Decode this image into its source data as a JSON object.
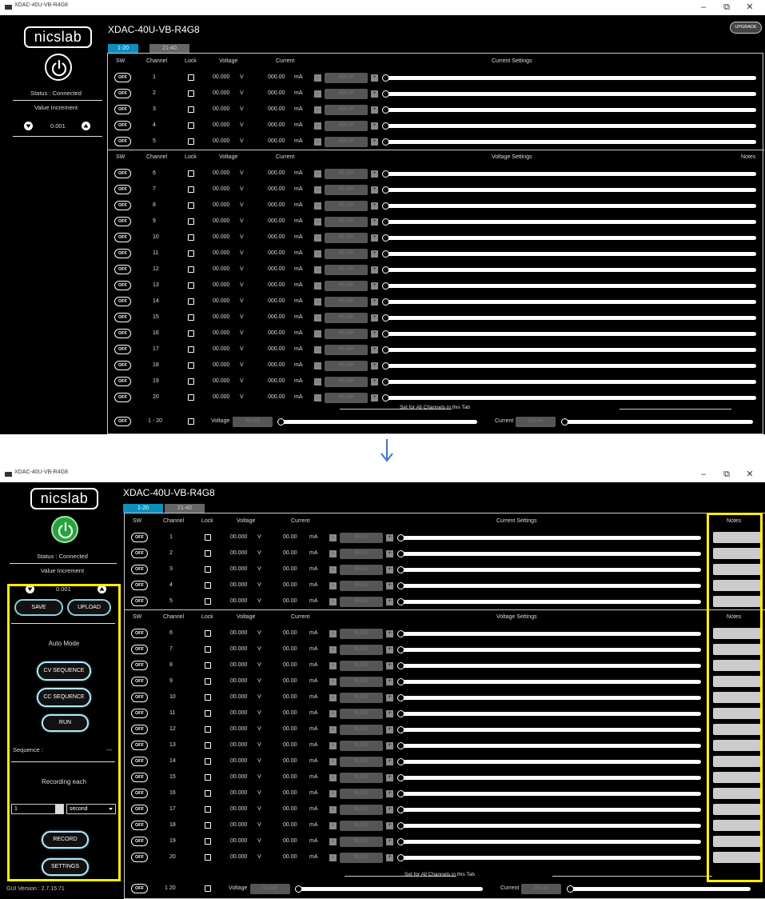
{
  "window": {
    "title": "XDAC-40U-VB-R4G8",
    "controls": {
      "minimize": "–",
      "maximize": "⧉",
      "close": "✕"
    }
  },
  "sidebar": {
    "logo": "nicslab",
    "status": "Status : Connected",
    "increment_label": "Value Increment",
    "increment_value": "0.001",
    "save": "SAVE",
    "upload": "UPLOAD",
    "auto_mode": "Auto Mode",
    "cv_sequence": "CV SEQUENCE",
    "cc_sequence": "CC SEQUENCE",
    "run": "RUN",
    "sequence_label": "Sequence :",
    "sequence_value": "---",
    "recording_each": "Recording each",
    "record_value": "1",
    "record_unit": "second",
    "record": "RECORD",
    "settings": "SETTINGS",
    "version": "GUI Version : 2.7.15.71"
  },
  "header": {
    "device": "XDAC-40U-VB-R4G8",
    "tabs": [
      "1-20",
      "21-40"
    ],
    "upgrade": "UPGRADE"
  },
  "columns": {
    "sw": "SW",
    "channel": "Channel",
    "lock": "Lock",
    "voltage": "Voltage",
    "current": "Current",
    "current_settings": "Current Settings",
    "voltage_settings": "Voltage Settings",
    "notes": "Notes"
  },
  "row_values": {
    "off": "OFF",
    "voltage": "00.000",
    "v_unit": "V",
    "current_before": "000.00",
    "current_after": "00.00",
    "ma_unit": "mA",
    "minus": "-",
    "plus": "+",
    "current_setting": "000.00",
    "voltage_setting": "00.000"
  },
  "channels_current": [
    "1",
    "2",
    "3",
    "4",
    "5"
  ],
  "channels_voltage": [
    "6",
    "7",
    "8",
    "9",
    "10",
    "11",
    "12",
    "13",
    "14",
    "15",
    "16",
    "17",
    "18",
    "19",
    "20"
  ],
  "footer": {
    "set_all": "Set for All Channels in this Tab",
    "range_before": "1 - 20",
    "range_after": "1  20",
    "voltage_label": "Voltage",
    "voltage_value": "00.000",
    "current_label": "Current",
    "current_value": "000.00"
  },
  "colors": {
    "tab_active": "#0c8fbf",
    "power_on": "#25a33a",
    "highlight": "#ffef00",
    "arrow": "#3b78c9"
  }
}
